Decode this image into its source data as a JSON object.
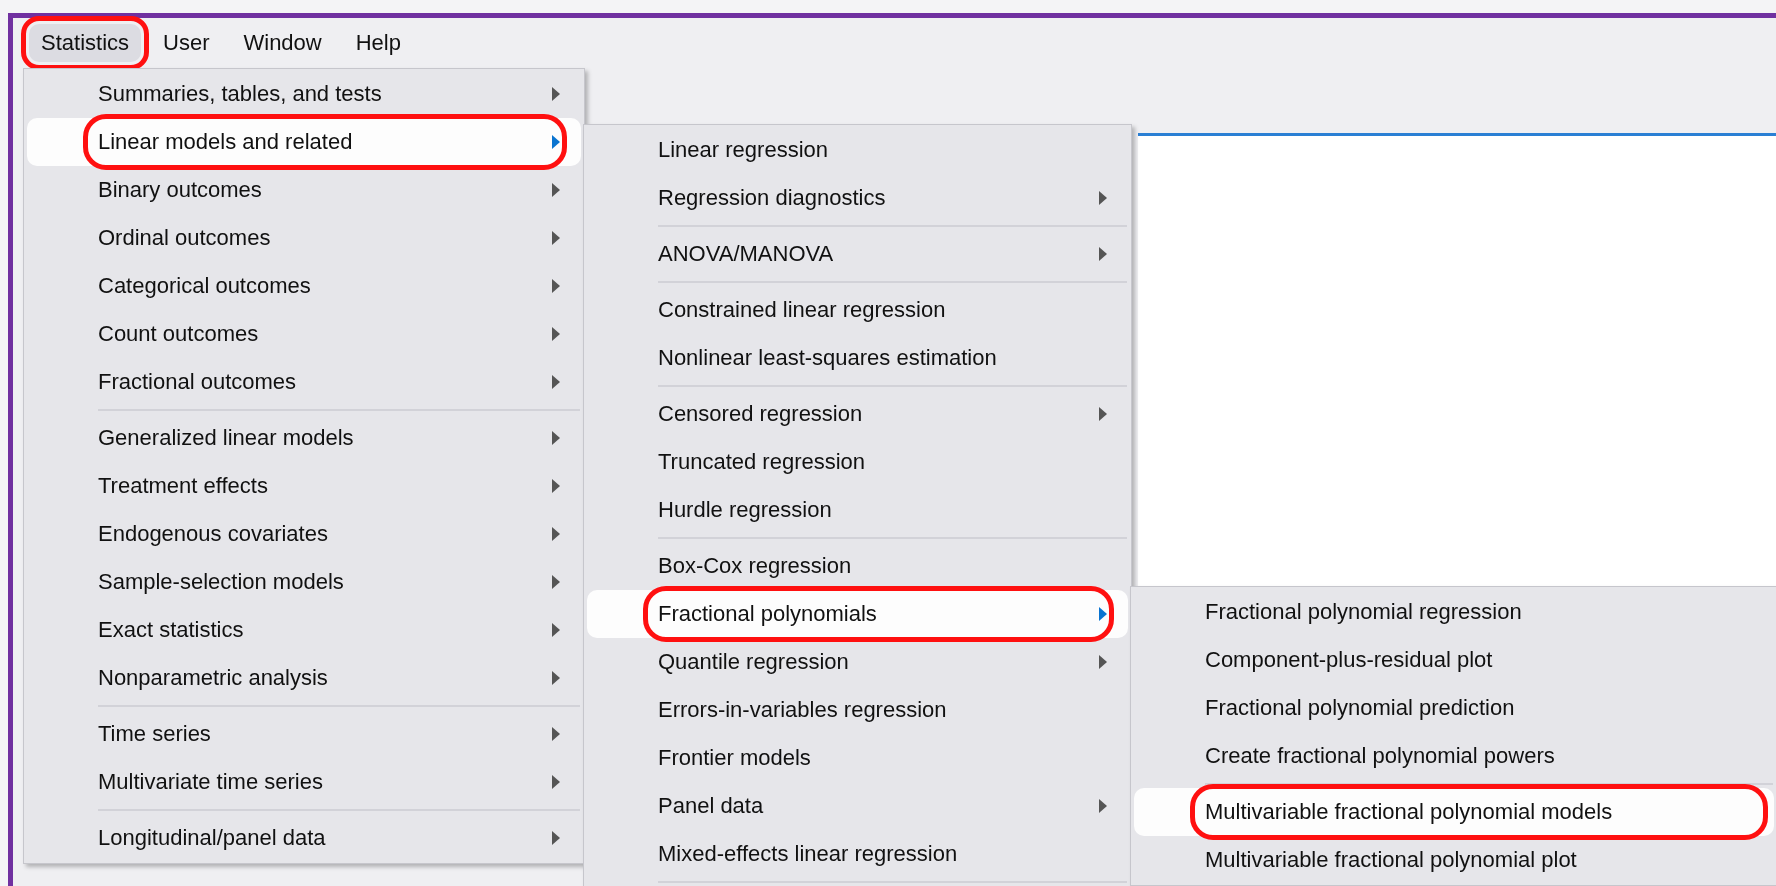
{
  "menubar": [
    {
      "label": "Statistics",
      "selected": true,
      "highlighted": true
    },
    {
      "label": "User",
      "selected": false,
      "highlighted": false
    },
    {
      "label": "Window",
      "selected": false,
      "highlighted": false
    },
    {
      "label": "Help",
      "selected": false,
      "highlighted": false
    }
  ],
  "menus": [
    {
      "items": [
        {
          "kind": "item",
          "label": "Summaries, tables, and tests",
          "submenu": true,
          "selected": false,
          "highlighted": false
        },
        {
          "kind": "item",
          "label": "Linear models and related",
          "submenu": true,
          "selected": true,
          "highlighted": true
        },
        {
          "kind": "item",
          "label": "Binary outcomes",
          "submenu": true,
          "selected": false,
          "highlighted": false
        },
        {
          "kind": "item",
          "label": "Ordinal outcomes",
          "submenu": true,
          "selected": false,
          "highlighted": false
        },
        {
          "kind": "item",
          "label": "Categorical outcomes",
          "submenu": true,
          "selected": false,
          "highlighted": false
        },
        {
          "kind": "item",
          "label": "Count outcomes",
          "submenu": true,
          "selected": false,
          "highlighted": false
        },
        {
          "kind": "item",
          "label": "Fractional outcomes",
          "submenu": true,
          "selected": false,
          "highlighted": false
        },
        {
          "kind": "separator"
        },
        {
          "kind": "item",
          "label": "Generalized linear models",
          "submenu": true,
          "selected": false,
          "highlighted": false
        },
        {
          "kind": "item",
          "label": "Treatment effects",
          "submenu": true,
          "selected": false,
          "highlighted": false
        },
        {
          "kind": "item",
          "label": "Endogenous covariates",
          "submenu": true,
          "selected": false,
          "highlighted": false
        },
        {
          "kind": "item",
          "label": "Sample-selection models",
          "submenu": true,
          "selected": false,
          "highlighted": false
        },
        {
          "kind": "item",
          "label": "Exact statistics",
          "submenu": true,
          "selected": false,
          "highlighted": false
        },
        {
          "kind": "item",
          "label": "Nonparametric analysis",
          "submenu": true,
          "selected": false,
          "highlighted": false
        },
        {
          "kind": "separator"
        },
        {
          "kind": "item",
          "label": "Time series",
          "submenu": true,
          "selected": false,
          "highlighted": false
        },
        {
          "kind": "item",
          "label": "Multivariate time series",
          "submenu": true,
          "selected": false,
          "highlighted": false
        },
        {
          "kind": "separator"
        },
        {
          "kind": "item",
          "label": "Longitudinal/panel data",
          "submenu": true,
          "selected": false,
          "highlighted": false
        }
      ]
    },
    {
      "items": [
        {
          "kind": "item",
          "label": "Linear regression",
          "submenu": false,
          "selected": false,
          "highlighted": false
        },
        {
          "kind": "item",
          "label": "Regression diagnostics",
          "submenu": true,
          "selected": false,
          "highlighted": false
        },
        {
          "kind": "separator"
        },
        {
          "kind": "item",
          "label": "ANOVA/MANOVA",
          "submenu": true,
          "selected": false,
          "highlighted": false
        },
        {
          "kind": "separator"
        },
        {
          "kind": "item",
          "label": "Constrained linear regression",
          "submenu": false,
          "selected": false,
          "highlighted": false
        },
        {
          "kind": "item",
          "label": "Nonlinear least-squares estimation",
          "submenu": false,
          "selected": false,
          "highlighted": false
        },
        {
          "kind": "separator"
        },
        {
          "kind": "item",
          "label": "Censored regression",
          "submenu": true,
          "selected": false,
          "highlighted": false
        },
        {
          "kind": "item",
          "label": "Truncated regression",
          "submenu": false,
          "selected": false,
          "highlighted": false
        },
        {
          "kind": "item",
          "label": "Hurdle regression",
          "submenu": false,
          "selected": false,
          "highlighted": false
        },
        {
          "kind": "separator"
        },
        {
          "kind": "item",
          "label": "Box-Cox regression",
          "submenu": false,
          "selected": false,
          "highlighted": false
        },
        {
          "kind": "item",
          "label": "Fractional polynomials",
          "submenu": true,
          "selected": true,
          "highlighted": true
        },
        {
          "kind": "item",
          "label": "Quantile regression",
          "submenu": true,
          "selected": false,
          "highlighted": false
        },
        {
          "kind": "item",
          "label": "Errors-in-variables regression",
          "submenu": false,
          "selected": false,
          "highlighted": false
        },
        {
          "kind": "item",
          "label": "Frontier models",
          "submenu": false,
          "selected": false,
          "highlighted": false
        },
        {
          "kind": "item",
          "label": "Panel data",
          "submenu": true,
          "selected": false,
          "highlighted": false
        },
        {
          "kind": "item",
          "label": "Mixed-effects linear regression",
          "submenu": false,
          "selected": false,
          "highlighted": false
        },
        {
          "kind": "separator"
        }
      ]
    },
    {
      "items": [
        {
          "kind": "item",
          "label": "Fractional polynomial regression",
          "submenu": false,
          "selected": false,
          "highlighted": false
        },
        {
          "kind": "item",
          "label": "Component-plus-residual plot",
          "submenu": false,
          "selected": false,
          "highlighted": false
        },
        {
          "kind": "item",
          "label": "Fractional polynomial prediction",
          "submenu": false,
          "selected": false,
          "highlighted": false
        },
        {
          "kind": "item",
          "label": "Create fractional polynomial powers",
          "submenu": false,
          "selected": false,
          "highlighted": false
        },
        {
          "kind": "separator"
        },
        {
          "kind": "item",
          "label": "Multivariable fractional polynomial models",
          "submenu": false,
          "selected": true,
          "highlighted": true
        },
        {
          "kind": "item",
          "label": "Multivariable fractional polynomial plot",
          "submenu": false,
          "selected": false,
          "highlighted": false
        }
      ]
    }
  ]
}
